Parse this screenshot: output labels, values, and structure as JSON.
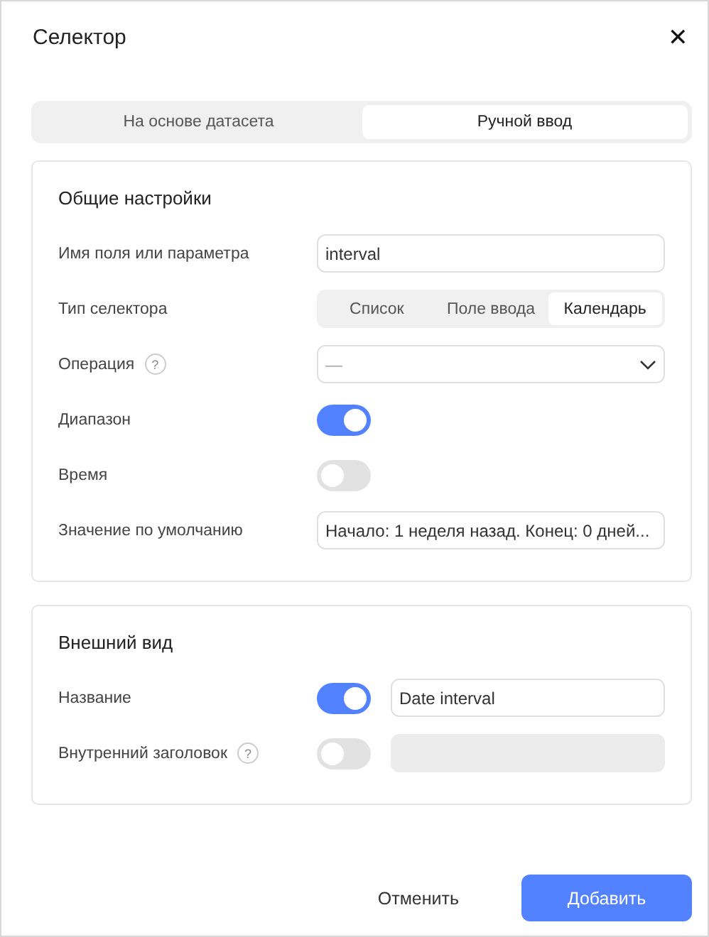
{
  "dialog": {
    "title": "Селектор",
    "close": "✕"
  },
  "source_tabs": [
    {
      "label": "На основе датасета",
      "selected": false
    },
    {
      "label": "Ручной ввод",
      "selected": true
    }
  ],
  "sections": [
    {
      "title": "Общие настройки",
      "rows": [
        {
          "kind": "input",
          "label": "Имя поля или параметра",
          "value": "interval"
        },
        {
          "kind": "segmented",
          "label": "Тип селектора",
          "options": [
            {
              "label": "Список",
              "selected": false
            },
            {
              "label": "Поле ввода",
              "selected": false
            },
            {
              "label": "Календарь",
              "selected": true
            }
          ]
        },
        {
          "kind": "select",
          "label": "Операция",
          "help": "?",
          "value": "—"
        },
        {
          "kind": "toggle",
          "label": "Диапазон",
          "on": true
        },
        {
          "kind": "toggle",
          "label": "Время",
          "on": false
        },
        {
          "kind": "input",
          "label": "Значение по умолчанию",
          "value": "Начало: 1 неделя назад. Конец: 0 дней..."
        }
      ]
    },
    {
      "title": "Внешний вид",
      "rows": [
        {
          "kind": "toggle_input",
          "label": "Название",
          "on": true,
          "value": "Date interval",
          "disabled": false
        },
        {
          "kind": "toggle_input",
          "label": "Внутренний заголовок",
          "help": "?",
          "on": false,
          "disabled": true
        }
      ]
    }
  ],
  "buttons": [
    {
      "label": "Отменить",
      "kind": "secondary"
    },
    {
      "label": "Добавить",
      "kind": "primary"
    }
  ]
}
